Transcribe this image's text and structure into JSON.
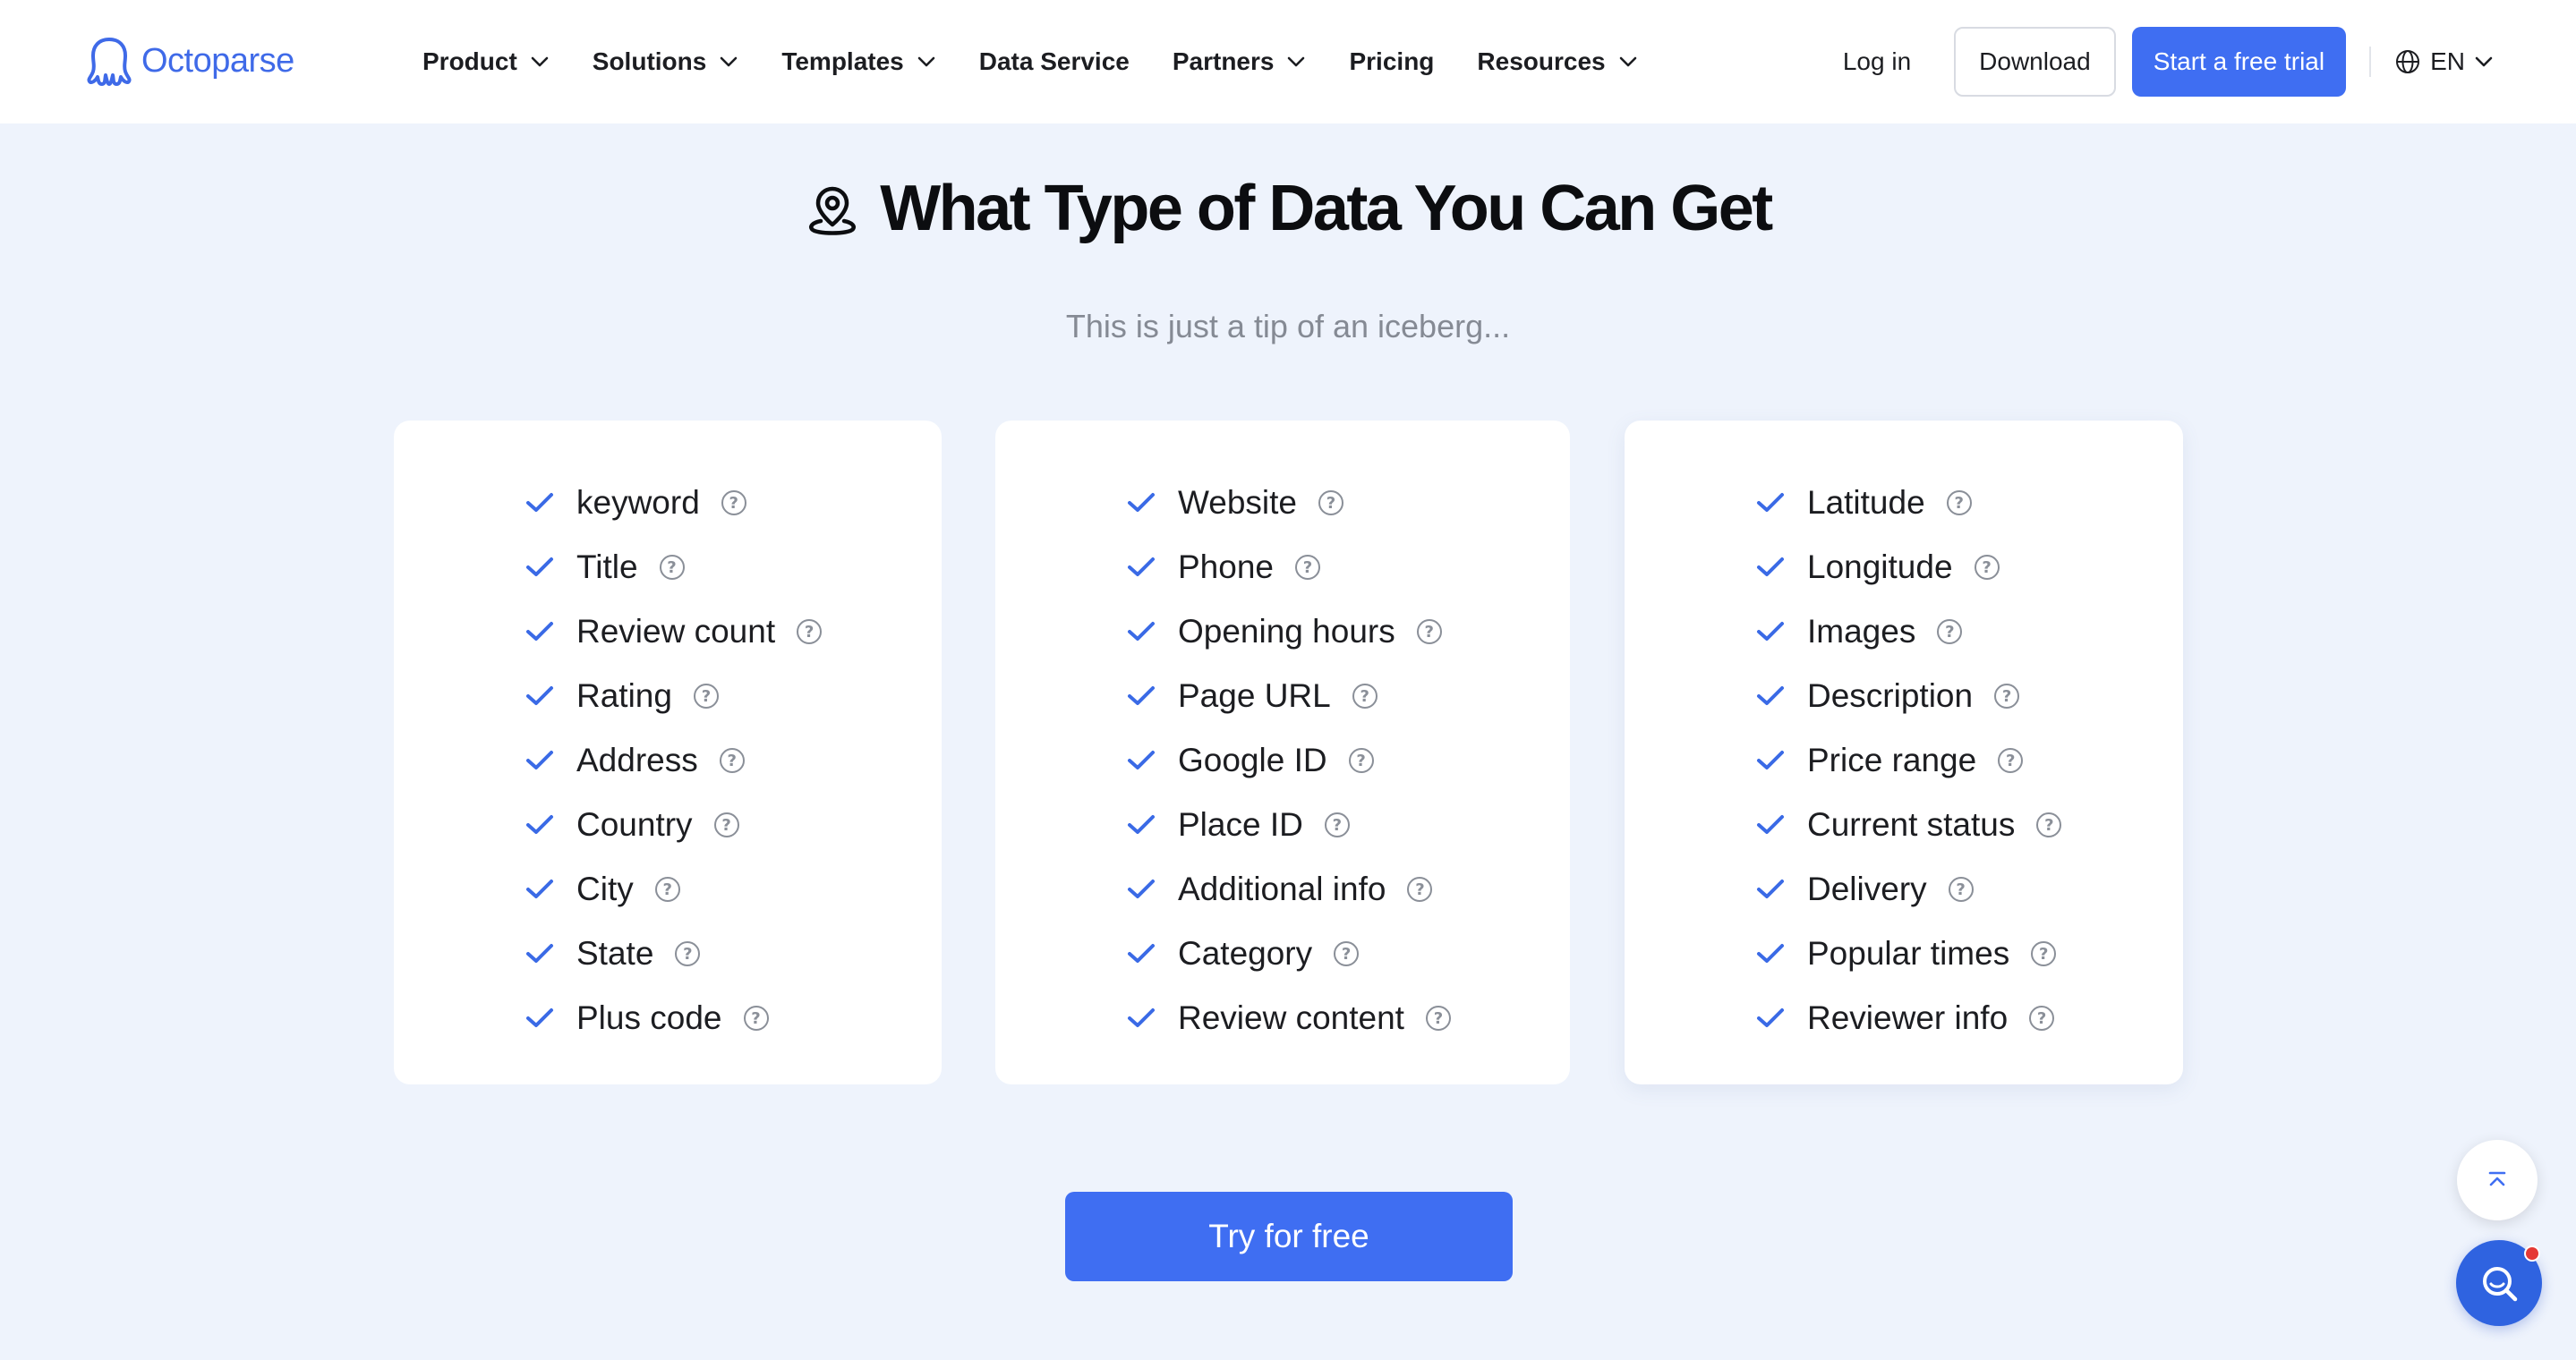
{
  "header": {
    "logo_text": "Octoparse",
    "nav": [
      {
        "label": "Product",
        "has_dropdown": true
      },
      {
        "label": "Solutions",
        "has_dropdown": true
      },
      {
        "label": "Templates",
        "has_dropdown": true
      },
      {
        "label": "Data Service",
        "has_dropdown": false
      },
      {
        "label": "Partners",
        "has_dropdown": true
      },
      {
        "label": "Pricing",
        "has_dropdown": false
      },
      {
        "label": "Resources",
        "has_dropdown": true
      }
    ],
    "login_label": "Log in",
    "download_label": "Download",
    "trial_label": "Start a free trial",
    "lang_label": "EN"
  },
  "section": {
    "icon": "location-pin-icon",
    "title": "What Type of Data You Can Get",
    "subtitle": "This is just a tip of an iceberg..."
  },
  "columns": [
    [
      "keyword",
      "Title",
      "Review count",
      "Rating",
      "Address",
      "Country",
      "City",
      "State",
      "Plus code"
    ],
    [
      "Website",
      "Phone",
      "Opening hours",
      "Page URL",
      "Google ID",
      "Place ID",
      "Additional info",
      "Category",
      "Review content"
    ],
    [
      "Latitude",
      "Longitude",
      "Images",
      "Description",
      "Price range",
      "Current status",
      "Delivery",
      "Popular times",
      "Reviewer info"
    ]
  ],
  "cta_label": "Try for free",
  "colors": {
    "accent": "#3f6ef2",
    "background": "#eef3fc",
    "logo": "#3f6ae8",
    "check": "#3a6ae6"
  }
}
